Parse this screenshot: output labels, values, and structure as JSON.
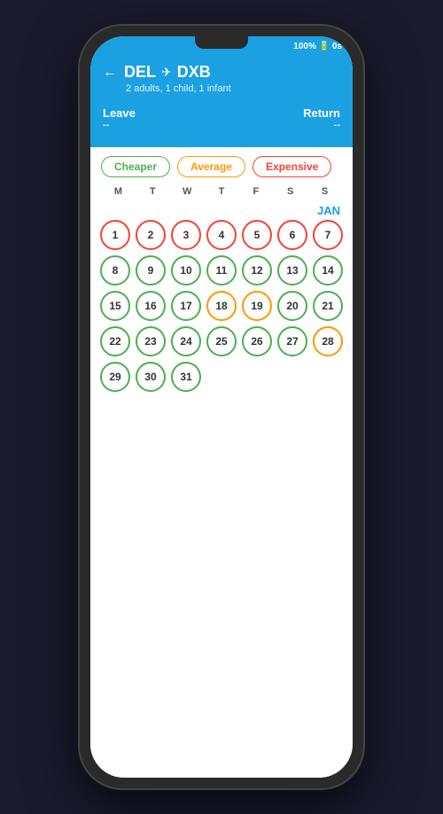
{
  "status": {
    "battery": "100%",
    "battery_icon": "🔋",
    "time": "0s"
  },
  "header": {
    "back_label": "←",
    "origin": "DEL",
    "destination": "DXB",
    "plane": "✈",
    "passengers": "2 adults, 1 child, 1 infant",
    "leave_label": "Leave",
    "return_label": "Return",
    "leave_value": "--",
    "return_value": "--"
  },
  "filters": {
    "cheaper_label": "Cheaper",
    "average_label": "Average",
    "expensive_label": "Expensive"
  },
  "calendar": {
    "month_label": "JAN",
    "day_headers": [
      "M",
      "T",
      "W",
      "T",
      "F",
      "S",
      "S"
    ],
    "weeks": [
      [
        {
          "day": 1,
          "type": "exp"
        },
        {
          "day": 2,
          "type": "exp"
        },
        {
          "day": 3,
          "type": "exp"
        },
        {
          "day": 4,
          "type": "exp"
        },
        {
          "day": 5,
          "type": "exp"
        },
        {
          "day": 6,
          "type": "exp"
        },
        {
          "day": 7,
          "type": "exp"
        }
      ],
      [
        {
          "day": 8,
          "type": "cheap"
        },
        {
          "day": 9,
          "type": "cheap"
        },
        {
          "day": 10,
          "type": "cheap"
        },
        {
          "day": 11,
          "type": "cheap"
        },
        {
          "day": 12,
          "type": "cheap"
        },
        {
          "day": 13,
          "type": "cheap"
        },
        {
          "day": 14,
          "type": "cheap"
        }
      ],
      [
        {
          "day": 15,
          "type": "cheap"
        },
        {
          "day": 16,
          "type": "cheap"
        },
        {
          "day": 17,
          "type": "cheap"
        },
        {
          "day": 18,
          "type": "avg"
        },
        {
          "day": 19,
          "type": "avg"
        },
        {
          "day": 20,
          "type": "cheap"
        },
        {
          "day": 21,
          "type": "cheap"
        }
      ],
      [
        {
          "day": 22,
          "type": "cheap"
        },
        {
          "day": 23,
          "type": "cheap"
        },
        {
          "day": 24,
          "type": "cheap"
        },
        {
          "day": 25,
          "type": "cheap"
        },
        {
          "day": 26,
          "type": "cheap"
        },
        {
          "day": 27,
          "type": "cheap"
        },
        {
          "day": 28,
          "type": "avg"
        }
      ],
      [
        {
          "day": 29,
          "type": "cheap"
        },
        {
          "day": 30,
          "type": "cheap"
        },
        {
          "day": 31,
          "type": "cheap"
        },
        null,
        null,
        null,
        null
      ]
    ]
  }
}
